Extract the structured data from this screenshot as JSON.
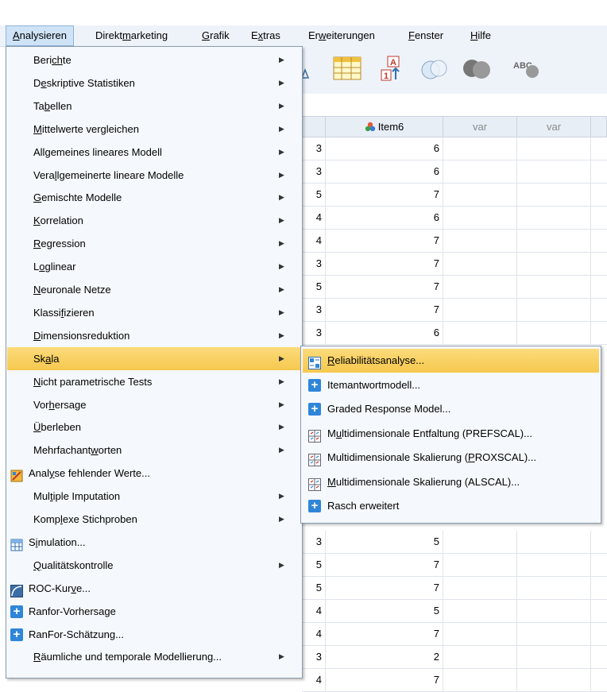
{
  "menubar": [
    {
      "pre": "",
      "u": "A",
      "post": "nalysieren",
      "active": true
    },
    {
      "pre": "Direkt",
      "u": "m",
      "post": "arketing"
    },
    {
      "pre": "",
      "u": "G",
      "post": "rafik"
    },
    {
      "pre": "E",
      "u": "x",
      "post": "tras"
    },
    {
      "pre": "Er",
      "u": "w",
      "post": "eiterungen"
    },
    {
      "pre": "",
      "u": "F",
      "post": "enster"
    },
    {
      "pre": "",
      "u": "H",
      "post": "ilfe"
    }
  ],
  "main_menu": [
    {
      "pre": "Beri",
      "u": "ch",
      "post": "te",
      "submenu": true
    },
    {
      "pre": "D",
      "u": "e",
      "post": "skriptive Statistiken",
      "submenu": true
    },
    {
      "pre": "Ta",
      "u": "b",
      "post": "ellen",
      "submenu": true
    },
    {
      "pre": "",
      "u": "M",
      "post": "ittelwerte vergleichen",
      "submenu": true
    },
    {
      "pre": "All",
      "u": "g",
      "post": "emeines lineares Modell",
      "submenu": true
    },
    {
      "pre": "Vera",
      "u": "l",
      "post": "lgemeinerte lineare Modelle",
      "submenu": true
    },
    {
      "pre": "",
      "u": "G",
      "post": "emischte Modelle",
      "submenu": true
    },
    {
      "pre": "",
      "u": "K",
      "post": "orrelation",
      "submenu": true
    },
    {
      "pre": "",
      "u": "R",
      "post": "egression",
      "submenu": true
    },
    {
      "pre": "L",
      "u": "o",
      "post": "glinear",
      "submenu": true
    },
    {
      "pre": "",
      "u": "N",
      "post": "euronale Netze",
      "submenu": true
    },
    {
      "pre": "Klassi",
      "u": "f",
      "post": "izieren",
      "submenu": true
    },
    {
      "pre": "",
      "u": "D",
      "post": "imensionsreduktion",
      "submenu": true
    },
    {
      "pre": "Sk",
      "u": "a",
      "post": "la",
      "submenu": true,
      "highlight": true
    },
    {
      "pre": "",
      "u": "N",
      "post": "icht parametrische Tests",
      "submenu": true
    },
    {
      "pre": "Vor",
      "u": "h",
      "post": "ersage",
      "submenu": true
    },
    {
      "pre": "",
      "u": "Ü",
      "post": "berleben",
      "submenu": true
    },
    {
      "pre": "Mehrfachant",
      "u": "w",
      "post": "orten",
      "submenu": true
    },
    {
      "pre": "Anal",
      "u": "y",
      "post": "se fehlender Werte...",
      "submenu": false,
      "icon": "missing-values-icon"
    },
    {
      "pre": "Mul",
      "u": "t",
      "post": "iple Imputation",
      "submenu": true
    },
    {
      "pre": "Komp",
      "u": "l",
      "post": "exe Stichproben",
      "submenu": true
    },
    {
      "pre": "S",
      "u": "i",
      "post": "mulation...",
      "submenu": false,
      "icon": "simulation-icon"
    },
    {
      "pre": "",
      "u": "Q",
      "post": "ualitätskontrolle",
      "submenu": true
    },
    {
      "pre": "ROC-Kur",
      "u": "v",
      "post": "e...",
      "submenu": false,
      "icon": "roc-curve-icon"
    },
    {
      "pre": "Ranfor-Vorhersage",
      "u": "",
      "post": "",
      "submenu": false,
      "icon": "plus-icon"
    },
    {
      "pre": "RanFor-Schätzung...",
      "u": "",
      "post": "",
      "submenu": false,
      "icon": "plus-icon"
    },
    {
      "pre": "",
      "u": "R",
      "post": "äumliche und temporale Modellierung...",
      "submenu": true
    }
  ],
  "scale_submenu": [
    {
      "pre": "",
      "u": "R",
      "post": "eliabilitätsanalyse...",
      "icon": "reliability-icon",
      "highlight": true
    },
    {
      "pre": "Itemantwortmodell...",
      "u": "",
      "post": "",
      "icon": "plus-icon"
    },
    {
      "pre": "Graded Response Model...",
      "u": "",
      "post": "",
      "icon": "plus-icon"
    },
    {
      "pre": "M",
      "u": "u",
      "post": "ltidimensionale Entfaltung (PREFSCAL)...",
      "icon": "prefscal-icon"
    },
    {
      "pre": "Multidimensionale Skalierung (",
      "u": "P",
      "post": "ROXSCAL)...",
      "icon": "proxscal-icon"
    },
    {
      "pre": "",
      "u": "M",
      "post": "ultidimensionale Skalierung (ALSCAL)...",
      "icon": "alscal-icon"
    },
    {
      "pre": "Rasch erweitert",
      "u": "",
      "post": "",
      "icon": "plus-icon"
    }
  ],
  "grid": {
    "headers": [
      "",
      "Item6",
      "var",
      "var"
    ],
    "rows_top": [
      [
        "3",
        "6"
      ],
      [
        "3",
        "6"
      ],
      [
        "5",
        "7"
      ],
      [
        "4",
        "6"
      ],
      [
        "4",
        "7"
      ],
      [
        "3",
        "7"
      ],
      [
        "5",
        "7"
      ],
      [
        "3",
        "7"
      ],
      [
        "3",
        "6"
      ]
    ],
    "rows_bottom": [
      [
        "3",
        "5"
      ],
      [
        "5",
        "7"
      ],
      [
        "5",
        "7"
      ],
      [
        "4",
        "5"
      ],
      [
        "4",
        "7"
      ],
      [
        "3",
        "2"
      ],
      [
        "4",
        "7"
      ]
    ]
  },
  "colors": {
    "highlight": "#f6c84f",
    "menu_bg": "#f5f8fc",
    "accent": "#2f86d8"
  }
}
